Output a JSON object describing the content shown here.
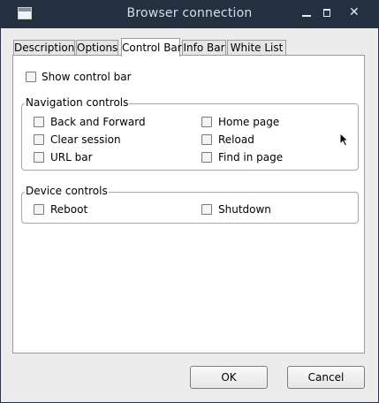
{
  "window": {
    "title": "Browser connection"
  },
  "tabs": [
    {
      "label": "Description"
    },
    {
      "label": "Options"
    },
    {
      "label": "Control Bar"
    },
    {
      "label": "Info Bar"
    },
    {
      "label": "White List"
    }
  ],
  "active_tab": "Control Bar",
  "control_bar": {
    "show_control_bar": {
      "label": "Show control bar",
      "checked": false
    }
  },
  "navigation_controls": {
    "title": "Navigation controls",
    "items": [
      {
        "label": "Back and Forward",
        "checked": false
      },
      {
        "label": "Clear session",
        "checked": false
      },
      {
        "label": "URL bar",
        "checked": false
      },
      {
        "label": "Home page",
        "checked": false
      },
      {
        "label": "Reload",
        "checked": false
      },
      {
        "label": "Find in page",
        "checked": false
      }
    ]
  },
  "device_controls": {
    "title": "Device controls",
    "items": [
      {
        "label": "Reboot",
        "checked": false
      },
      {
        "label": "Shutdown",
        "checked": false
      }
    ]
  },
  "buttons": {
    "ok": "OK",
    "cancel": "Cancel"
  },
  "icons": {
    "app": "window-icon",
    "minimize": "minimize-icon",
    "maximize": "maximize-icon",
    "close": "close-icon"
  }
}
